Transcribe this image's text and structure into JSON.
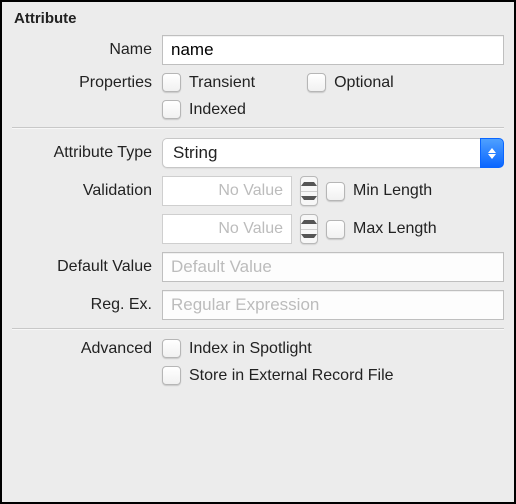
{
  "section_title": "Attribute",
  "labels": {
    "name": "Name",
    "properties": "Properties",
    "attribute_type": "Attribute Type",
    "validation": "Validation",
    "default_value": "Default Value",
    "regex": "Reg. Ex.",
    "advanced": "Advanced"
  },
  "fields": {
    "name_value": "name",
    "attribute_type_selected": "String",
    "min_length_value": "No Value",
    "max_length_value": "No Value",
    "default_value_placeholder": "Default Value",
    "regex_placeholder": "Regular Expression"
  },
  "checkboxes": {
    "transient": "Transient",
    "optional": "Optional",
    "indexed": "Indexed",
    "min_length": "Min Length",
    "max_length": "Max Length",
    "index_spotlight": "Index in Spotlight",
    "store_external": "Store in External Record File"
  }
}
